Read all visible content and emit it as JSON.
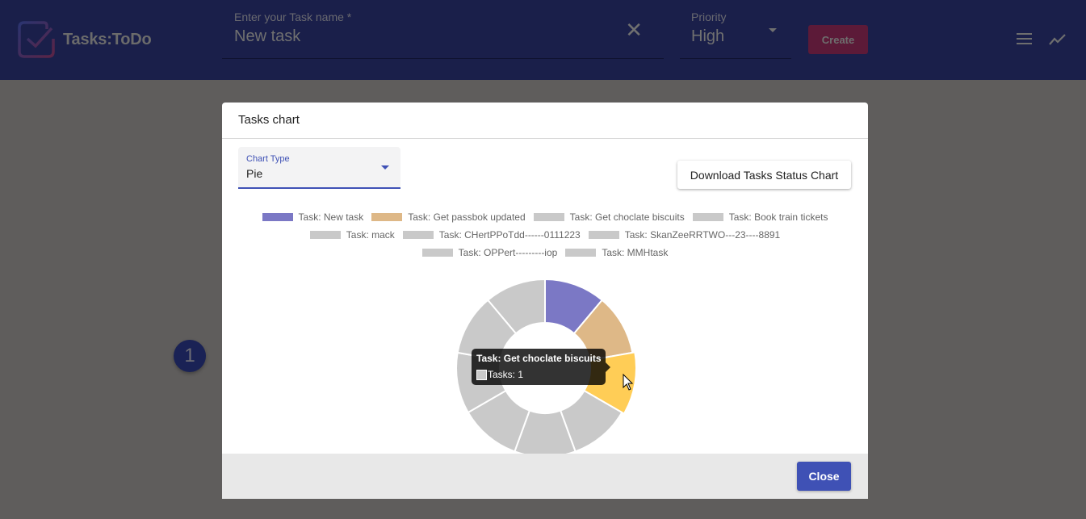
{
  "header": {
    "brand": "Tasks:ToDo",
    "task_input": {
      "label": "Enter your Task name *",
      "value": "New task",
      "clear_icon": "close-icon"
    },
    "priority_select": {
      "label": "Priority",
      "value": "High"
    },
    "create_label": "Create",
    "menu_icon": "menu-icon",
    "chart_icon": "trending-up-icon"
  },
  "page": {
    "badge": "1"
  },
  "dialog": {
    "title": "Tasks chart",
    "chart_type": {
      "label": "Chart Type",
      "value": "Pie"
    },
    "download_label": "Download Tasks Status Chart",
    "close_label": "Close",
    "tooltip": {
      "title": "Task: Get choclate biscuits",
      "body": "Tasks: 1"
    }
  },
  "chart_data": {
    "type": "pie",
    "variant": "doughnut",
    "legend_position": "top",
    "categories": [
      "Task: New task",
      "Task: Get passbok updated",
      "Task: Get choclate biscuits",
      "Task: Book train tickets",
      "Task: mack",
      "Task: CHertPPoTdd------0111223",
      "Task: SkanZeeRRTWO---23----8891",
      "Task: OPPert---------iop",
      "Task: MMHtask"
    ],
    "values": [
      1,
      1,
      1,
      1,
      1,
      1,
      1,
      1,
      1
    ],
    "series_name": "Tasks",
    "slice_colors": [
      "#7b78c5",
      "#deb887",
      "#ffcd56",
      "#c9c9c9",
      "#c9c9c9",
      "#c9c9c9",
      "#c9c9c9",
      "#c9c9c9",
      "#c9c9c9"
    ],
    "legend_colors": [
      "#7b78c5",
      "#deb887",
      "#c9c9c9",
      "#c9c9c9",
      "#c9c9c9",
      "#c9c9c9",
      "#c9c9c9",
      "#c9c9c9",
      "#c9c9c9"
    ],
    "hovered_index": 2,
    "legend_rows": [
      [
        0,
        1,
        2,
        3
      ],
      [
        4,
        5,
        6
      ],
      [
        7,
        8
      ]
    ]
  }
}
